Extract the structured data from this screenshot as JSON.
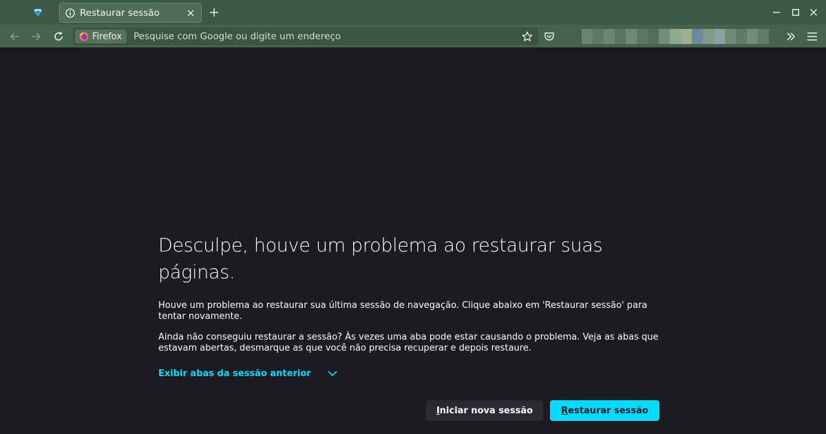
{
  "tabs": [
    {
      "title": "Restaurar sessão",
      "active": true
    }
  ],
  "urlbar": {
    "identity_label": "Firefox",
    "placeholder": "Pesquise com Google ou digite um endereço",
    "value": ""
  },
  "page": {
    "title": "Desculpe, houve um problema ao restaurar suas páginas.",
    "paragraph1": "Houve um problema ao restaurar sua última sessão de navegação. Clique abaixo em 'Restaurar sessão' para tentar novamente.",
    "paragraph2": "Ainda não conseguiu restaurar a sessão? Às vezes uma aba pode estar causando o problema. Veja as abas que estavam abertas, desmarque as que você não precisa recuperar e depois restaure.",
    "toggle_label": "Exibir abas da sessão anterior",
    "new_session_button": {
      "accesskey": "I",
      "rest": "niciar nova sessão"
    },
    "restore_button": {
      "accesskey": "R",
      "rest": "estaurar sessão"
    }
  },
  "icons": {
    "pinned_tab": "diamond-favicon-icon",
    "tab_favicon": "info-icon",
    "tab_close": "close-icon",
    "new_tab": "plus-icon",
    "back": "arrow-left-icon",
    "forward": "arrow-right-icon",
    "reload": "reload-icon",
    "identity": "firefox-logo-icon",
    "bookmark": "star-icon",
    "pocket": "pocket-icon",
    "overflow": "chevron-double-right-icon",
    "menu": "hamburger-menu-icon",
    "toggle": "chevron-down-icon"
  },
  "colors": {
    "tabstrip": "#3c5a44",
    "navbar": "#45644d",
    "content_bg": "#1c1b22",
    "accent": "#00ddff",
    "text": "#fbfbfe"
  }
}
